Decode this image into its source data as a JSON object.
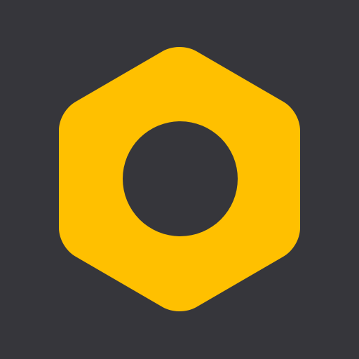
{
  "app_icon": {
    "icon": "hex-nut-icon",
    "colors": {
      "background": "#36363b",
      "nut": "#ffc000",
      "hole": "#36363b"
    }
  }
}
